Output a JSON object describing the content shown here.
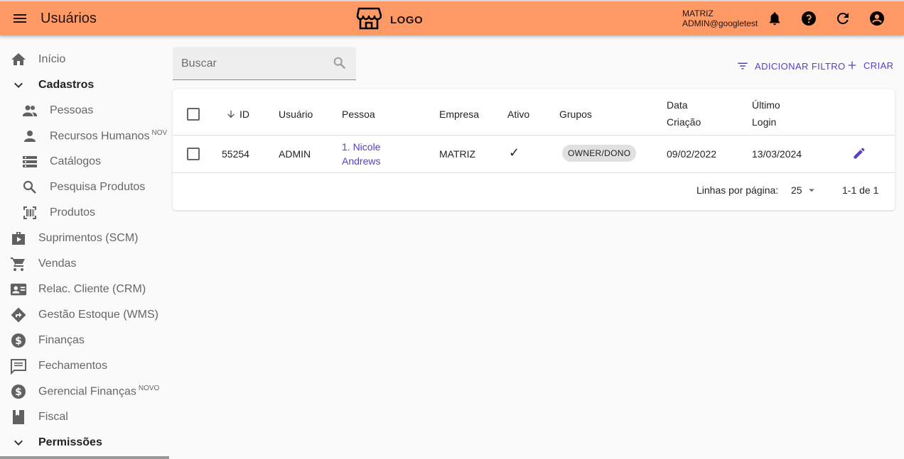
{
  "appbar": {
    "title": "Usuários",
    "logo_text": "LOGO",
    "company": "MATRIZ",
    "user": "ADMIN@googletest",
    "accent": "#ff9966"
  },
  "sidebar": {
    "items": [
      {
        "label": "Início",
        "icon": "home-icon"
      },
      {
        "label": "Cadastros",
        "icon": "chevron-down-icon",
        "section": true
      },
      {
        "label": "Pessoas",
        "icon": "people-icon",
        "sub": true
      },
      {
        "label": "Recursos Humanos",
        "badge": "NOV",
        "icon": "person-icon",
        "sub": true
      },
      {
        "label": "Catálogos",
        "icon": "list-icon",
        "sub": true
      },
      {
        "label": "Pesquisa Produtos",
        "icon": "search-icon",
        "sub": true
      },
      {
        "label": "Produtos",
        "icon": "barcode-icon",
        "sub": true
      },
      {
        "label": "Suprimentos (SCM)",
        "icon": "bag-icon"
      },
      {
        "label": "Vendas",
        "icon": "cart-icon"
      },
      {
        "label": "Relac. Cliente (CRM)",
        "icon": "contact-card-icon"
      },
      {
        "label": "Gestão Estoque (WMS)",
        "icon": "directions-icon"
      },
      {
        "label": "Finanças",
        "icon": "dollar-icon"
      },
      {
        "label": "Fechamentos",
        "icon": "message-icon"
      },
      {
        "label": "Gerencial Finanças",
        "badge": "NOVO",
        "icon": "dollar-icon"
      },
      {
        "label": "Fiscal",
        "icon": "book-icon"
      },
      {
        "label": "Permissões",
        "icon": "chevron-down-icon",
        "section": true
      }
    ]
  },
  "search": {
    "placeholder": "Buscar"
  },
  "actions": {
    "add_filter": "ADICIONAR FILTRO",
    "create": "CRIAR"
  },
  "table": {
    "columns": [
      "ID",
      "Usuário",
      "Pessoa",
      "Empresa",
      "Ativo",
      "Grupos",
      "Data Criação",
      "Último Login"
    ],
    "column_lines": {
      "data_criacao": [
        "Data",
        "Criação"
      ],
      "ultimo_login": [
        "Último",
        "Login"
      ]
    },
    "rows": [
      {
        "id": "55254",
        "usuario": "ADMIN",
        "pessoa_line1": "1. Nicole",
        "pessoa_line2": "Andrews",
        "empresa": "MATRIZ",
        "ativo": "✓",
        "grupo": "OWNER/DONO",
        "data_criacao": "09/02/2022",
        "ultimo_login": "13/03/2024"
      }
    ]
  },
  "pagination": {
    "rows_label": "Linhas por página:",
    "rows_value": "25",
    "range": "1-1 de 1"
  }
}
